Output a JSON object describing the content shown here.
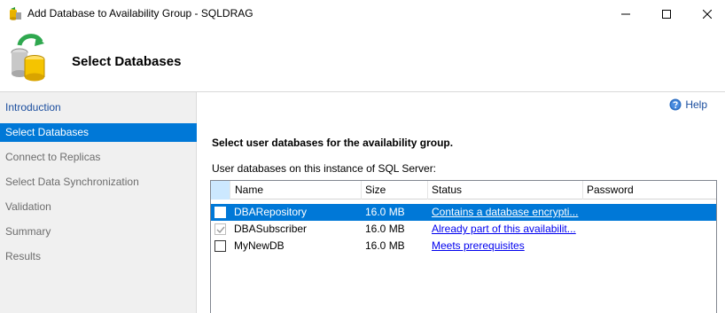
{
  "window": {
    "title": "Add Database to Availability Group - SQLDRAG",
    "minimize_label": "Minimize",
    "maximize_label": "Maximize",
    "close_label": "Close"
  },
  "header": {
    "title": "Select Databases"
  },
  "nav": {
    "items": [
      {
        "label": "Introduction",
        "state": "link"
      },
      {
        "label": "Select Databases",
        "state": "selected"
      },
      {
        "label": "Connect to Replicas",
        "state": "disabled"
      },
      {
        "label": "Select Data Synchronization",
        "state": "disabled"
      },
      {
        "label": "Validation",
        "state": "disabled"
      },
      {
        "label": "Summary",
        "state": "disabled"
      },
      {
        "label": "Results",
        "state": "disabled"
      }
    ]
  },
  "help": {
    "label": "Help"
  },
  "main": {
    "instruction": "Select user databases for the availability group.",
    "grid_label": "User databases on this instance of SQL Server:"
  },
  "grid": {
    "columns": [
      "Name",
      "Size",
      "Status",
      "Password"
    ],
    "rows": [
      {
        "checked": false,
        "selected": true,
        "name": "DBARepository",
        "size": "16.0 MB",
        "status": "Contains a database encrypti...",
        "password": ""
      },
      {
        "checked": true,
        "selected": false,
        "name": "DBASubscriber",
        "size": "16.0 MB",
        "status": "Already part of this availabilit...",
        "password": ""
      },
      {
        "checked": false,
        "selected": false,
        "name": "MyNewDB",
        "size": "16.0 MB",
        "status": "Meets prerequisites",
        "password": ""
      }
    ]
  },
  "colors": {
    "selection": "#0078d7",
    "link": "#1a4d9e",
    "nav_background": "#f0f0f0"
  }
}
